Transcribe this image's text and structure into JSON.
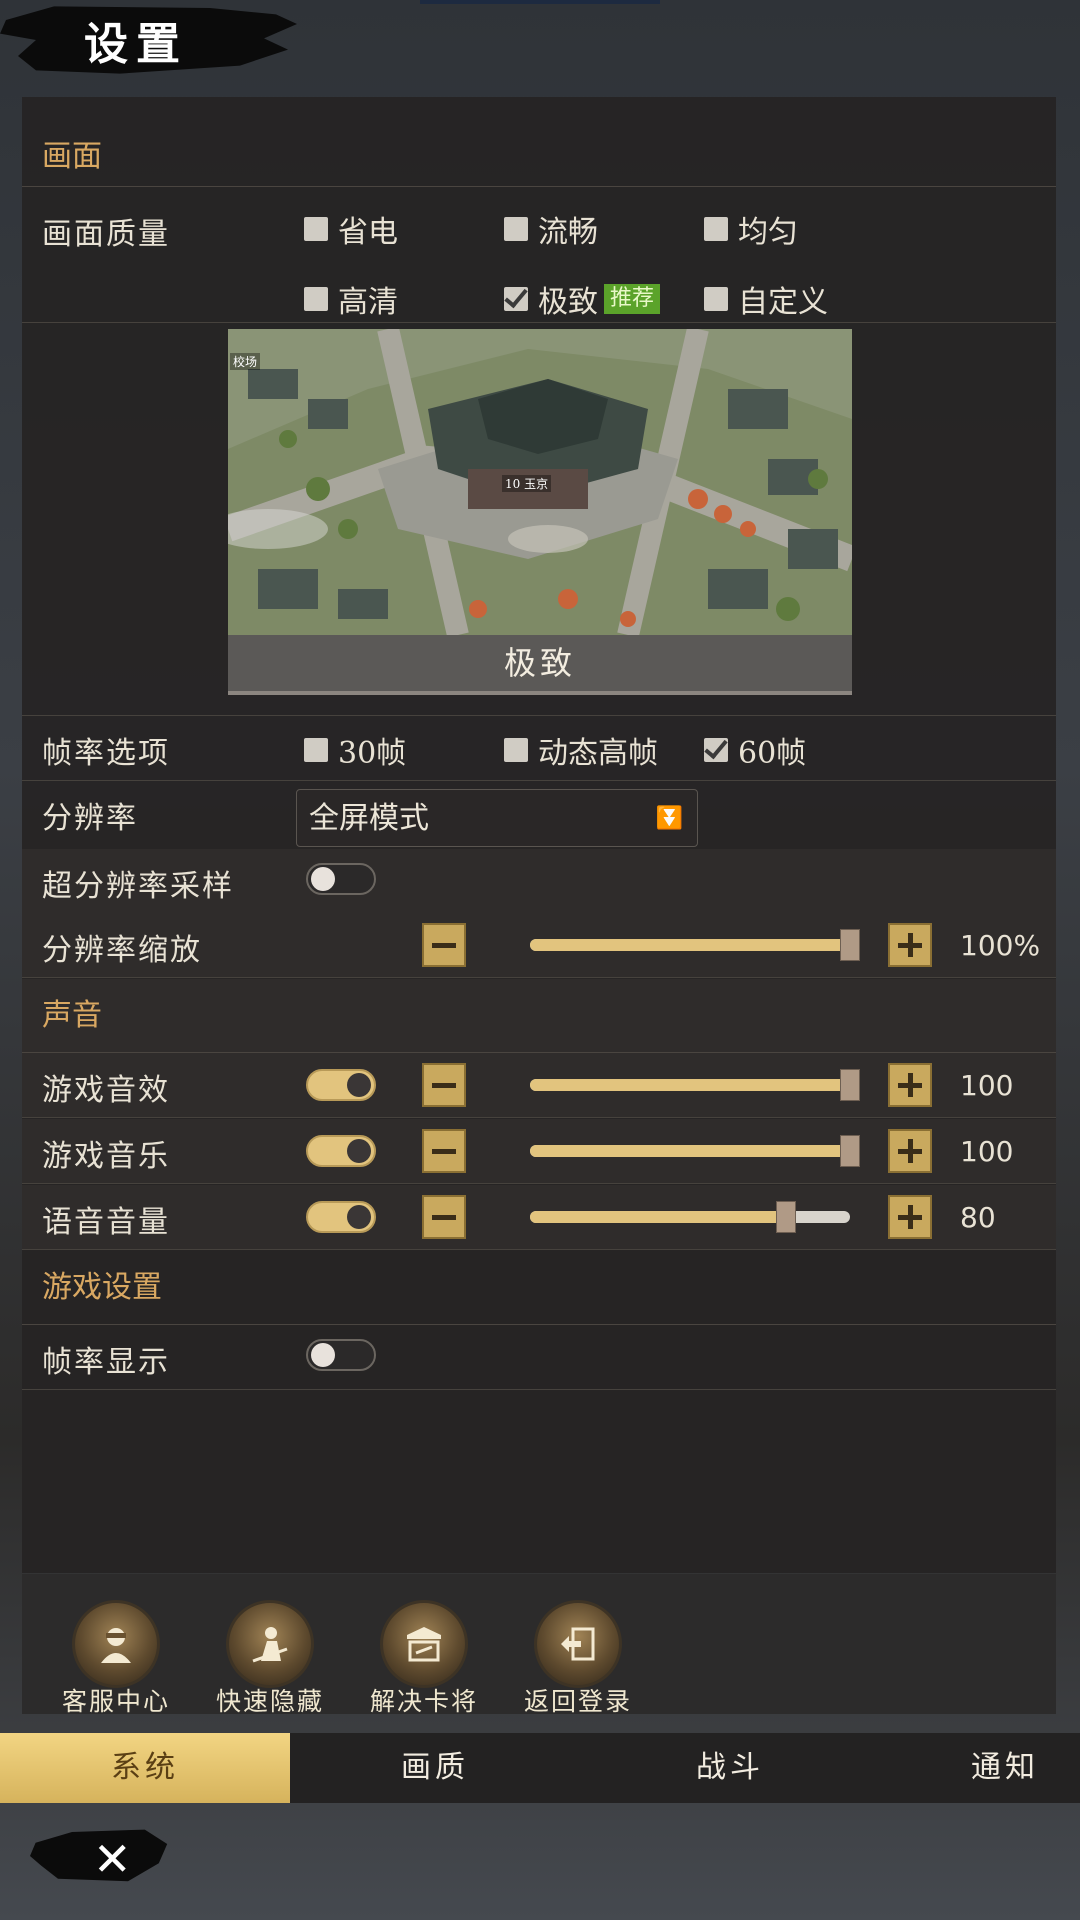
{
  "header": {
    "title": "设置"
  },
  "sections": {
    "display": "画面",
    "sound": "声音",
    "game": "游戏设置"
  },
  "quality": {
    "label": "画面质量",
    "options": [
      {
        "label": "省电",
        "checked": false
      },
      {
        "label": "流畅",
        "checked": false
      },
      {
        "label": "均匀",
        "checked": false
      },
      {
        "label": "高清",
        "checked": false
      },
      {
        "label": "极致",
        "checked": true
      },
      {
        "label": "自定义",
        "checked": false
      }
    ],
    "recommend_badge": "推荐",
    "preview_caption": "极致",
    "preview_map_labels": [
      "校场",
      "10 玉京"
    ]
  },
  "framerate": {
    "label": "帧率选项",
    "options": [
      {
        "label": "30帧",
        "checked": false
      },
      {
        "label": "动态高帧",
        "checked": false
      },
      {
        "label": "60帧",
        "checked": true
      }
    ]
  },
  "resolution": {
    "label": "分辨率",
    "value": "全屏模式"
  },
  "super_sampling": {
    "label": "超分辨率采样",
    "on": false
  },
  "resolution_scale": {
    "label": "分辨率缩放",
    "value_text": "100%",
    "level": 1.0
  },
  "sound": {
    "effects": {
      "label": "游戏音效",
      "on": true,
      "value_text": "100",
      "level": 1.0
    },
    "music": {
      "label": "游戏音乐",
      "on": true,
      "value_text": "100",
      "level": 1.0
    },
    "voice": {
      "label": "语音音量",
      "on": true,
      "value_text": "80",
      "level": 0.8
    }
  },
  "fps_display": {
    "label": "帧率显示",
    "on": false
  },
  "actions": [
    {
      "label": "客服中心",
      "icon": "customer-service-icon"
    },
    {
      "label": "快速隐藏",
      "icon": "quick-hide-icon"
    },
    {
      "label": "解决卡将",
      "icon": "fix-stuck-icon"
    },
    {
      "label": "返回登录",
      "icon": "return-login-icon"
    }
  ],
  "tabs": [
    {
      "label": "系统",
      "active": true
    },
    {
      "label": "画质",
      "active": false
    },
    {
      "label": "战斗",
      "active": false
    },
    {
      "label": "通知",
      "active": false
    }
  ],
  "colors": {
    "accent": "#d9a862",
    "active_tab": "#e8c66e",
    "toggle_on": "#e2c47e",
    "recommend": "#5ba32a"
  }
}
